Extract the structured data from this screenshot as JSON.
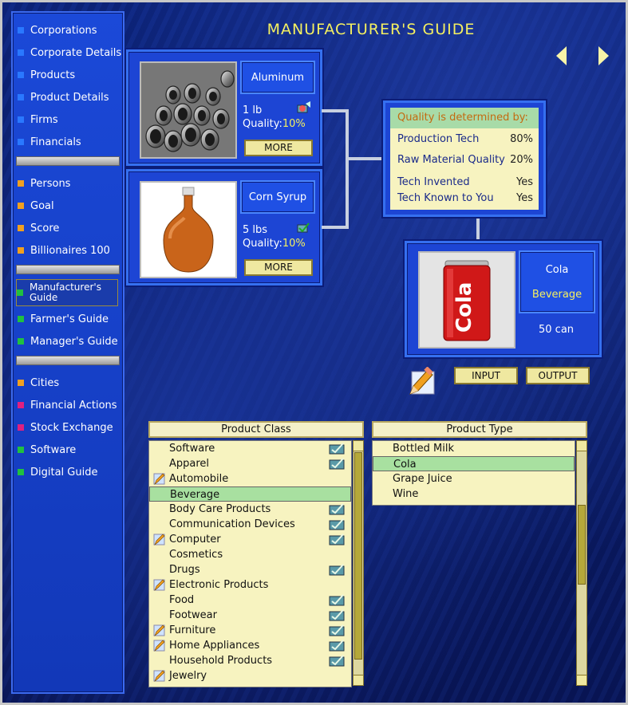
{
  "title": "MANUFACTURER'S GUIDE",
  "sidebar": {
    "groups": [
      [
        {
          "label": "Corporations",
          "color": "#2a78ff"
        },
        {
          "label": "Corporate Details",
          "color": "#2a78ff"
        },
        {
          "label": "Products",
          "color": "#2a78ff"
        },
        {
          "label": "Product Details",
          "color": "#2a78ff"
        },
        {
          "label": "Firms",
          "color": "#2a78ff"
        },
        {
          "label": "Financials",
          "color": "#2a78ff"
        }
      ],
      [
        {
          "label": "Persons",
          "color": "#f0a020"
        },
        {
          "label": "Goal",
          "color": "#f0a020"
        },
        {
          "label": "Score",
          "color": "#f0a020"
        },
        {
          "label": "Billionaires 100",
          "color": "#f0a020"
        }
      ],
      [
        {
          "label": "Manufacturer's Guide",
          "color": "#20c040"
        },
        {
          "label": "Farmer's Guide",
          "color": "#20c040"
        },
        {
          "label": "Manager's Guide",
          "color": "#20c040"
        }
      ],
      [
        {
          "label": "Cities",
          "color": "#f0a020"
        },
        {
          "label": "Financial Actions",
          "color": "#e02080"
        },
        {
          "label": "Stock Exchange",
          "color": "#e02080"
        },
        {
          "label": "Software",
          "color": "#20c040"
        },
        {
          "label": "Digital Guide",
          "color": "#20c040"
        }
      ]
    ]
  },
  "inputs": [
    {
      "name": "Aluminum",
      "quantity": "1 lb",
      "quality_label": "Quality:",
      "quality_value": "10%",
      "more": "MORE",
      "image": "aluminum-tubes"
    },
    {
      "name": "Corn Syrup",
      "quantity": "5 lbs",
      "quality_label": "Quality:",
      "quality_value": "10%",
      "more": "MORE",
      "image": "syrup-bottle"
    }
  ],
  "quality": {
    "heading": "Quality is determined by:",
    "rows": [
      {
        "label": "Production Tech",
        "value": "80%"
      },
      {
        "label": "Raw Material Quality",
        "value": "20%"
      },
      {
        "label": "Tech Invented",
        "value": "Yes"
      },
      {
        "label": "Tech Known to You",
        "value": "Yes"
      }
    ]
  },
  "output": {
    "name": "Cola",
    "type": "Beverage",
    "quantity": "50 can",
    "can_text": "Cola"
  },
  "buttons": {
    "input": "INPUT",
    "output": "OUTPUT"
  },
  "product_class": {
    "header": "Product Class",
    "items": [
      {
        "label": "Software",
        "left_icon": false,
        "right_icon": true
      },
      {
        "label": "Apparel",
        "left_icon": false,
        "right_icon": true
      },
      {
        "label": "Automobile",
        "left_icon": true,
        "right_icon": false
      },
      {
        "label": "Beverage",
        "left_icon": false,
        "right_icon": false,
        "selected": true
      },
      {
        "label": "Body Care Products",
        "left_icon": false,
        "right_icon": true
      },
      {
        "label": "Communication Devices",
        "left_icon": false,
        "right_icon": true
      },
      {
        "label": "Computer",
        "left_icon": true,
        "right_icon": true
      },
      {
        "label": "Cosmetics",
        "left_icon": false,
        "right_icon": false
      },
      {
        "label": "Drugs",
        "left_icon": false,
        "right_icon": true
      },
      {
        "label": "Electronic Products",
        "left_icon": true,
        "right_icon": false
      },
      {
        "label": "Food",
        "left_icon": false,
        "right_icon": true
      },
      {
        "label": "Footwear",
        "left_icon": false,
        "right_icon": true
      },
      {
        "label": "Furniture",
        "left_icon": true,
        "right_icon": true
      },
      {
        "label": "Home Appliances",
        "left_icon": true,
        "right_icon": true
      },
      {
        "label": "Household Products",
        "left_icon": false,
        "right_icon": true
      },
      {
        "label": "Jewelry",
        "left_icon": true,
        "right_icon": false
      }
    ]
  },
  "product_type": {
    "header": "Product Type",
    "items": [
      {
        "label": "Bottled Milk"
      },
      {
        "label": "Cola",
        "selected": true
      },
      {
        "label": "Grape Juice"
      },
      {
        "label": "Wine"
      }
    ]
  },
  "icons": {
    "nav_prev": "left-arrow-icon",
    "nav_next": "right-arrow-icon",
    "edit": "pencil-icon",
    "tech": "tech-icon",
    "software": "software-icon"
  },
  "colors": {
    "title": "#f5f060",
    "panel": "#1d45d4",
    "list_bg": "#f7f3c0",
    "selected_row": "#a8e0a0"
  }
}
